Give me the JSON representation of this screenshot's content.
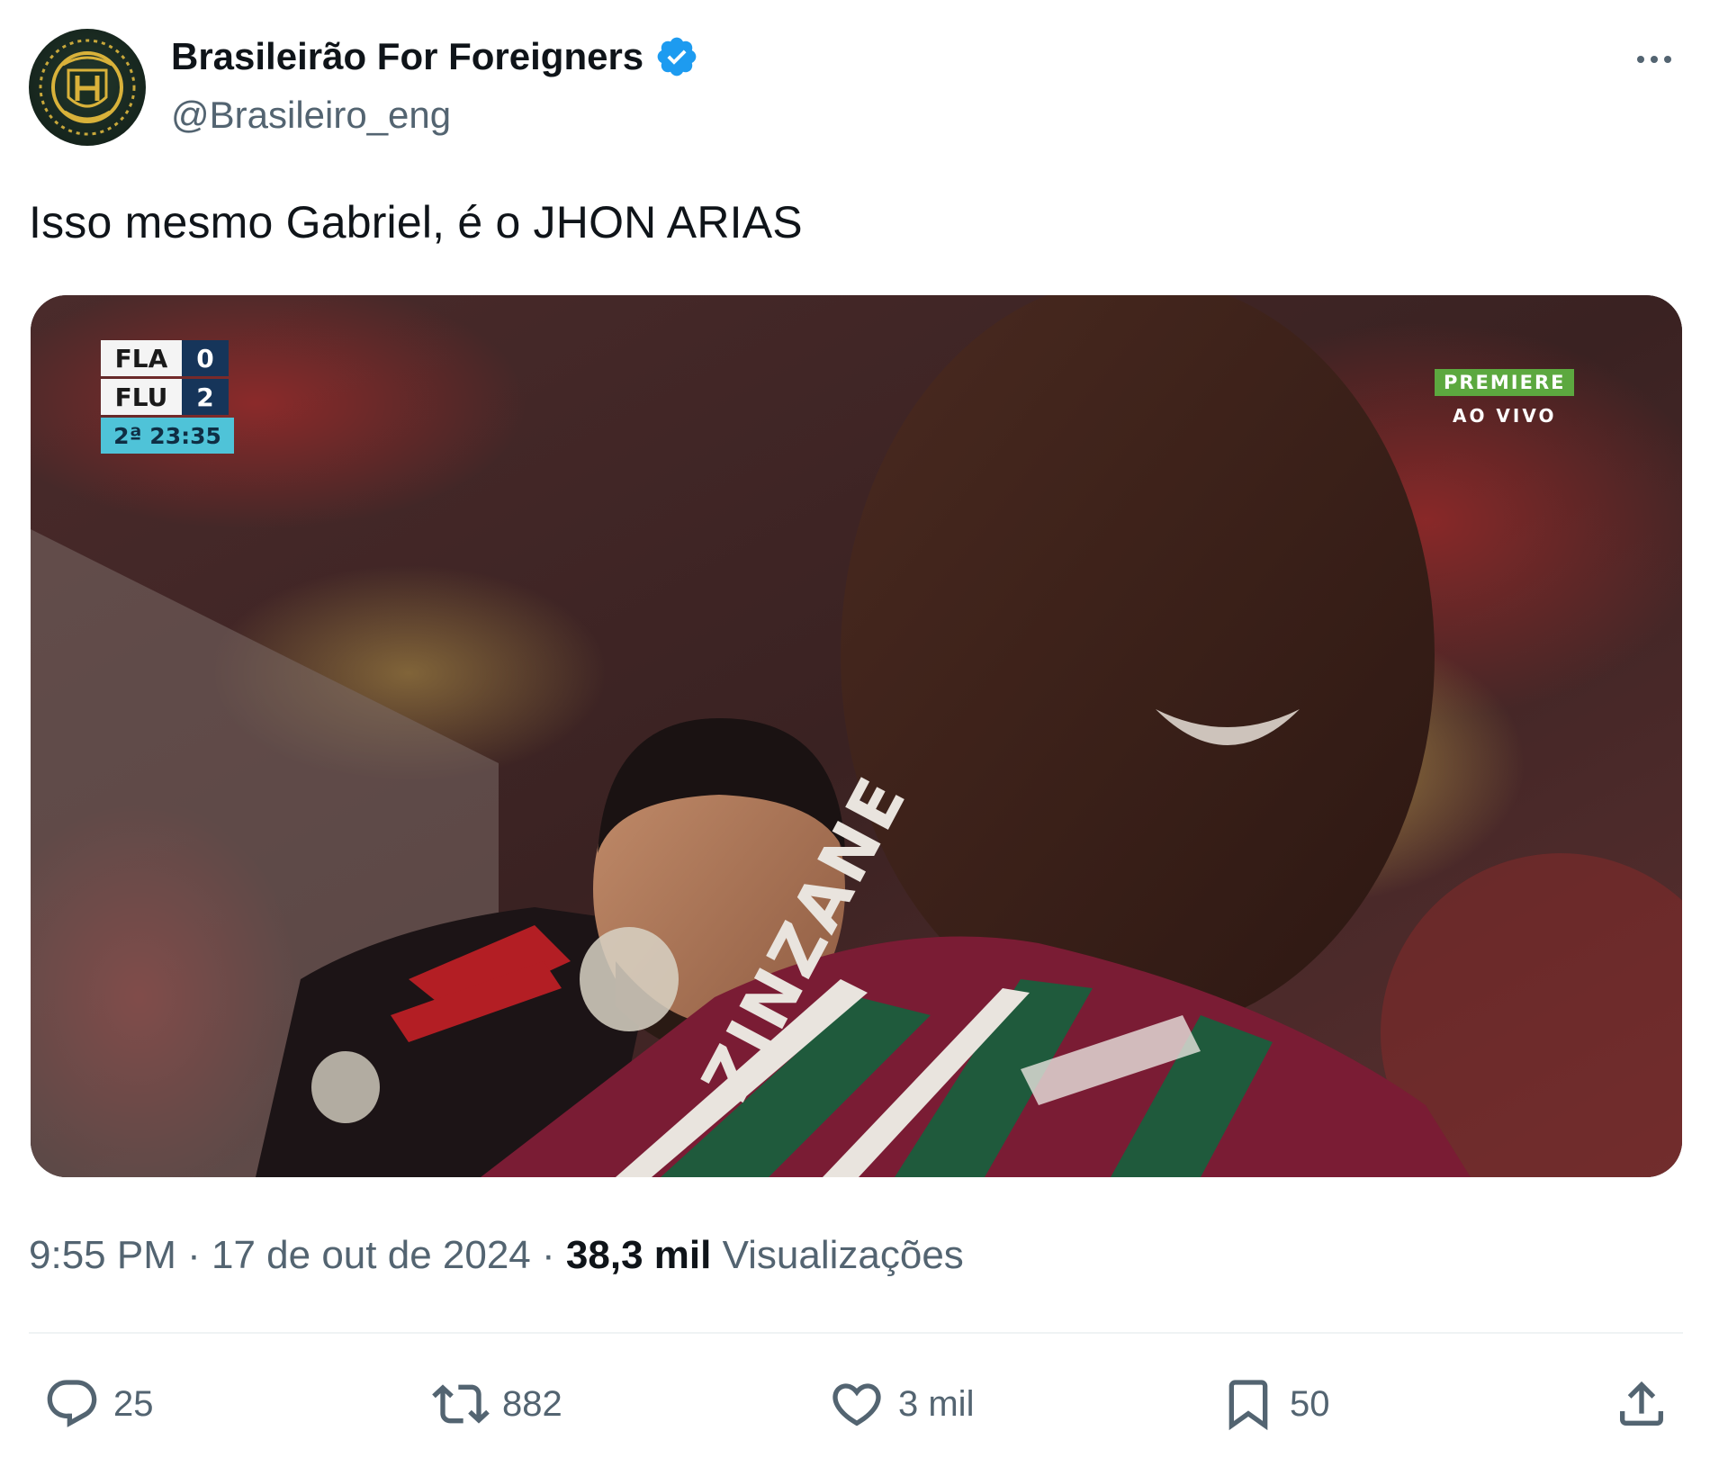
{
  "author": {
    "name": "Brasileirão For Foreigners",
    "handle": "@Brasileiro_eng",
    "verified": true,
    "avatar_colors": [
      "#16251d",
      "#d9b23a"
    ]
  },
  "tweet": {
    "text": "Isso mesmo Gabriel, é o JHON ARIAS",
    "time": "9:55 PM",
    "date": "17 de out de 2024",
    "views_count": "38,3 mil",
    "views_label": "Visualizações",
    "separator": "·"
  },
  "media": {
    "scoreboard": {
      "team1": "FLA",
      "score1": "0",
      "team2": "FLU",
      "score2": "2",
      "clock": "2ª 23:35"
    },
    "broadcaster": "PREMIERE",
    "live_label": "AO VIVO",
    "shirt_sponsor": "ZINZANE"
  },
  "actions": {
    "replies": "25",
    "retweets": "882",
    "likes": "3 mil",
    "bookmarks": "50"
  },
  "colors": {
    "text_primary": "#0f1419",
    "text_secondary": "#536471",
    "verified_blue": "#1d9bf0",
    "divider": "#eff3f4"
  }
}
